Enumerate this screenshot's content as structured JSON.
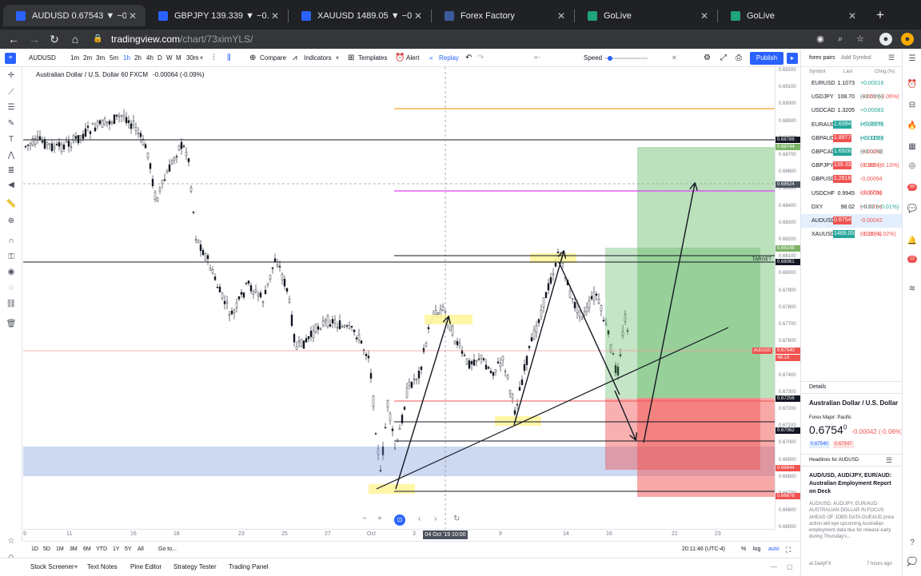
{
  "browser": {
    "tabs": [
      {
        "title": "AUDUSD 0.67543 ▼ −0.06%",
        "active": true
      },
      {
        "title": "GBPJPY 139.339 ▼ −0.13% ...",
        "active": false
      },
      {
        "title": "XAUUSD 1489.05 ▼ −0.02% ...",
        "active": false
      },
      {
        "title": "Forex Factory",
        "active": false
      },
      {
        "title": "GoLive",
        "active": false
      },
      {
        "title": "GoLive",
        "active": false
      }
    ],
    "url_domain": "tradingview.com",
    "url_path": "/chart/73ximYLS/"
  },
  "toolbar": {
    "symbol": "AUDUSD",
    "intervals": [
      "1m",
      "2m",
      "3m",
      "5m",
      "1h",
      "2h",
      "4h",
      "D",
      "W",
      "M",
      "30m"
    ],
    "compare": "Compare",
    "indicators": "Indicators",
    "templates": "Templates",
    "alert": "Alert",
    "replay": "Replay",
    "speed": "Speed",
    "publish": "Publish"
  },
  "legend": {
    "title": "Australian Dollar / U.S. Dollar  60  FXCM",
    "change": "-0.00064 (-0.09%)"
  },
  "chart": {
    "price_labels": [
      "0.69200",
      "0.69100",
      "0.69000",
      "0.68900",
      "0.68800",
      "0.68700",
      "0.68600",
      "0.68500",
      "0.68400",
      "0.68300",
      "0.68200",
      "0.68100",
      "0.68000",
      "0.67900",
      "0.67800",
      "0.67700",
      "0.67600",
      "0.67500",
      "0.67400",
      "0.67300",
      "0.67200",
      "0.67100",
      "0.67000",
      "0.66900",
      "0.66800",
      "0.66700",
      "0.66600",
      "0.66500"
    ],
    "price_badges": [
      {
        "text": "0.68788",
        "color": "#131722"
      },
      {
        "text": "0.68744",
        "color": "#7cb266"
      },
      {
        "text": "0.68524",
        "color": "#4c525e"
      },
      {
        "text": "0.68148",
        "color": "#7cb266"
      },
      {
        "text": "0.68061",
        "color": "#131722"
      },
      {
        "text": "0.67540",
        "color": "#ef5350"
      },
      {
        "text": "48:13",
        "color": "#ef5350"
      },
      {
        "text": "0.67256",
        "color": "#131722"
      },
      {
        "text": "0.67062",
        "color": "#131722"
      },
      {
        "text": "0.66844",
        "color": "#ef5350"
      },
      {
        "text": "0.66676",
        "color": "#ef5350"
      }
    ],
    "target_label": "TARGET",
    "audusd_tag": "AUDUSD",
    "time_labels": [
      "9",
      "11",
      "16",
      "18",
      "23",
      "25",
      "27",
      "Oct",
      "3",
      "9",
      "14",
      "16",
      "21",
      "23"
    ],
    "time_cursor": "04 Oct '19   10:00"
  },
  "bottom": {
    "ranges": [
      "1D",
      "5D",
      "1M",
      "3M",
      "6M",
      "YTD",
      "1Y",
      "5Y",
      "All"
    ],
    "goto": "Go to...",
    "clock": "20:11:46 (UTC-4)",
    "pct": "%",
    "log": "log",
    "auto": "auto"
  },
  "footer": [
    "Stock Screener",
    "Text Notes",
    "Pine Editor",
    "Strategy Tester",
    "Trading Panel"
  ],
  "watchlist": {
    "title": "forex pairs",
    "add_symbol": "Add Symbol",
    "headers": [
      "Symbol",
      "Last",
      "Chng (%)"
    ],
    "rows": [
      {
        "sym": "EURUSD",
        "last": "1.1073",
        "chg": "+0.00016 (+0.01%)",
        "dir": "pos",
        "badge": ""
      },
      {
        "sym": "USDJPY",
        "last": "108.70",
        "chg": "-0.060 (-0.06%)",
        "dir": "neg",
        "badge": ""
      },
      {
        "sym": "USDCAD",
        "last": "1.3205",
        "chg": "+0.00083 (+0.06%)",
        "dir": "pos",
        "badge": ""
      },
      {
        "sym": "EURAUD",
        "last": "1.6394",
        "chg": "+0.00175 (+0.11%)",
        "dir": "pos",
        "badge": "#26a69a"
      },
      {
        "sym": "GBPAUD",
        "last": "1.8977",
        "chg": "+0.00029 (+0.02%)",
        "dir": "pos",
        "badge": "#ef5350"
      },
      {
        "sym": "GBPCAD",
        "last": "1.6926",
        "chg": "-0.00052 (-0.03%)",
        "dir": "neg",
        "badge": "#26a69a"
      },
      {
        "sym": "GBPJPY",
        "last": "139.33",
        "chg": "-0.180 (-0.13%)",
        "dir": "neg",
        "badge": "#ef5350"
      },
      {
        "sym": "GBPUSD",
        "last": "1.2818",
        "chg": "-0.00094 (-0.07%)",
        "dir": "neg",
        "badge": "#ef5350"
      },
      {
        "sym": "USDCHF",
        "last": "0.9945",
        "chg": "-0.00026 (-0.03%)",
        "dir": "neg",
        "badge": ""
      },
      {
        "sym": "DXY",
        "last": "98.02",
        "chg": "+0.01 (+0.01%)",
        "dir": "pos",
        "badge": ""
      },
      {
        "sym": "AUDUSD",
        "last": "0.6754",
        "chg": "-0.00042 (-0.06%)",
        "dir": "neg",
        "badge": "#ef5350"
      },
      {
        "sym": "XAUUSD",
        "last": "1489.05",
        "chg": "-0.33 (-0.02%)",
        "dir": "neg",
        "badge": "#26a69a"
      }
    ],
    "details_title": "Details",
    "details_name": "Australian Dollar / U.S. Dollar",
    "details_exchange": "Forex Major: Pacific",
    "details_price": "0.6754",
    "details_price_sup": "0",
    "details_change": "-0.00042 (-0.06%)",
    "bid": "0.67540",
    "ask": "0.67547",
    "headlines_title": "Headlines for AUDUSD",
    "headline": "AUD/USD, AUD/JPY, EUR/AUD: Australian Employment Report on Deck",
    "snippet": "AUD/USD, AUD/JPY, EUR/AUD: AUSTRALIAN DOLLAR IN FOCUS AHEAD OF JOBS DATA DUEAUD price action will eye upcoming Australian employment data due for release early during Thursday's...",
    "source": "at DailyFX",
    "ago": "7 hours ago"
  }
}
